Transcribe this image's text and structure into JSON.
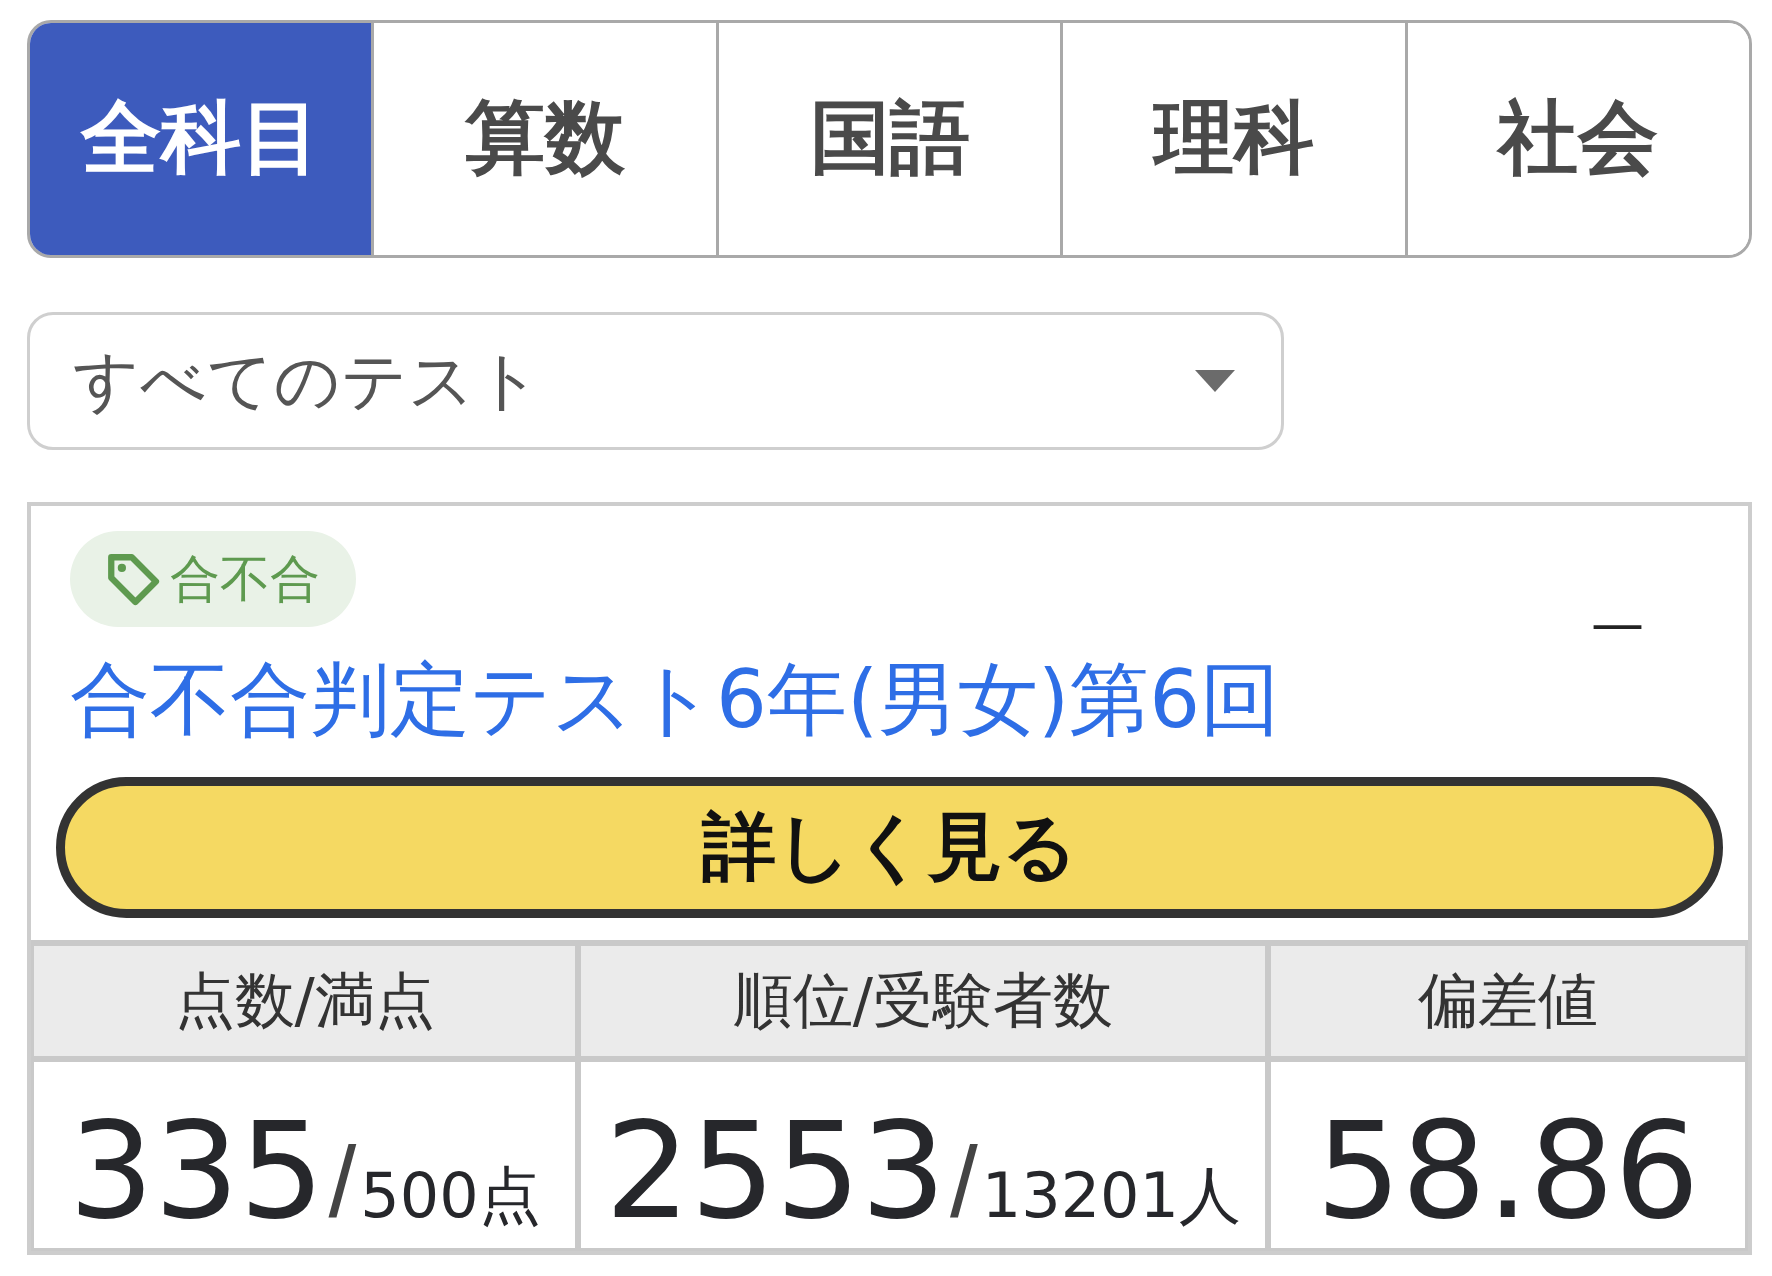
{
  "tabs": [
    {
      "label": "全科目",
      "selected": true
    },
    {
      "label": "算数",
      "selected": false
    },
    {
      "label": "国語",
      "selected": false
    },
    {
      "label": "理科",
      "selected": false
    },
    {
      "label": "社会",
      "selected": false
    }
  ],
  "test_select": {
    "value": "すべてのテスト"
  },
  "result_card": {
    "tag": "合不合",
    "corner_text": "—",
    "title": "合不合判定テスト6年(男女)第6回",
    "details_button": "詳しく見る",
    "table": {
      "columns": [
        "点数/満点",
        "順位/受験者数",
        "偏差値"
      ],
      "cells": [
        {
          "main": "335",
          "separator": "/",
          "sub": "500点"
        },
        {
          "main": "2553",
          "separator": "/",
          "sub": "13201人"
        },
        {
          "main": "58.86"
        }
      ]
    }
  }
}
